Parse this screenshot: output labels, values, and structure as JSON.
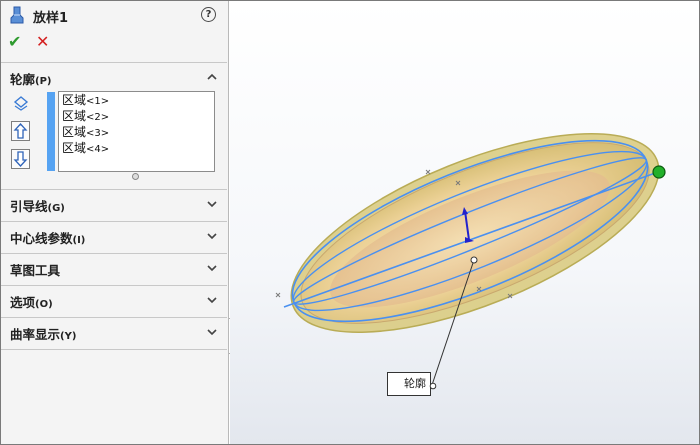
{
  "panel": {
    "title": "放样1",
    "help_glyph": "?",
    "ok_icon": "check-icon",
    "cancel_icon": "close-icon",
    "profiles": {
      "label": "轮廓",
      "hotkey": "(P)",
      "items": [
        {
          "name": "区域",
          "index": "<1>"
        },
        {
          "name": "区域",
          "index": "<2>"
        },
        {
          "name": "区域",
          "index": "<3>"
        },
        {
          "name": "区域",
          "index": "<4>"
        }
      ]
    },
    "sections": [
      {
        "label": "引导线",
        "hotkey": "(G)"
      },
      {
        "label": "中心线参数",
        "hotkey": "(I)"
      },
      {
        "label": "草图工具",
        "hotkey": ""
      },
      {
        "label": "选项",
        "hotkey": "(O)"
      },
      {
        "label": "曲率显示",
        "hotkey": "(Y)"
      }
    ]
  },
  "viewport": {
    "callout_label": "轮廓"
  },
  "colors": {
    "accent_blue": "#56a3f2",
    "ok_green": "#2e9a2e",
    "cancel_red": "#d42020",
    "profile_line": "#4a90f0",
    "solid_fill": "#e8cf93",
    "endpoint_green": "#22b02a"
  }
}
